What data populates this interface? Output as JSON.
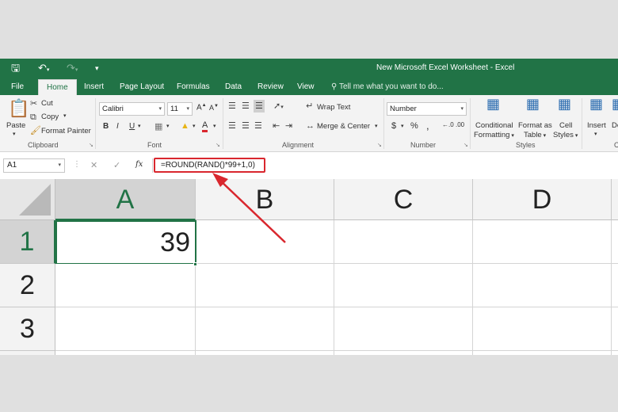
{
  "window": {
    "title": "New Microsoft Excel Worksheet - Excel"
  },
  "quick_access": {
    "save_icon": "save-icon",
    "undo_icon": "undo-icon",
    "redo_icon": "redo-icon",
    "customize_icon": "customize-icon"
  },
  "tabs": [
    {
      "label": "File"
    },
    {
      "label": "Home",
      "active": true
    },
    {
      "label": "Insert"
    },
    {
      "label": "Page Layout"
    },
    {
      "label": "Formulas"
    },
    {
      "label": "Data"
    },
    {
      "label": "Review"
    },
    {
      "label": "View"
    }
  ],
  "tell_me": {
    "placeholder": "Tell me what you want to do..."
  },
  "ribbon": {
    "clipboard": {
      "label": "Clipboard",
      "paste": "Paste",
      "cut": "Cut",
      "copy": "Copy",
      "format_painter": "Format Painter"
    },
    "font": {
      "label": "Font",
      "font_name": "Calibri",
      "font_size": "11",
      "bold": "B",
      "italic": "I",
      "underline": "U"
    },
    "alignment": {
      "label": "Alignment",
      "wrap_text": "Wrap Text",
      "merge_center": "Merge & Center"
    },
    "number": {
      "label": "Number",
      "format": "Number",
      "currency": "$",
      "percent": "%",
      "comma": ",",
      "increase_decimal": "←.0",
      "decrease_decimal": ".00"
    },
    "styles": {
      "label": "Styles",
      "conditional_formatting": [
        "Conditional",
        "Formatting"
      ],
      "format_as_table": [
        "Format as",
        "Table"
      ],
      "cell_styles": [
        "Cell",
        "Styles"
      ]
    },
    "cells": {
      "insert": "Insert",
      "delete_partial": "De",
      "label_partial": "C"
    }
  },
  "formula_bar": {
    "name_box": "A1",
    "cancel": "✕",
    "enter": "✓",
    "fx": "fx",
    "formula": "=ROUND(RAND()*99+1,0)"
  },
  "sheet": {
    "columns": [
      "A",
      "B",
      "C",
      "D"
    ],
    "rows": [
      "1",
      "2",
      "3"
    ],
    "active_cell_value": "39"
  },
  "colors": {
    "excel_green": "#217346",
    "annotation_red": "#d9272e"
  }
}
